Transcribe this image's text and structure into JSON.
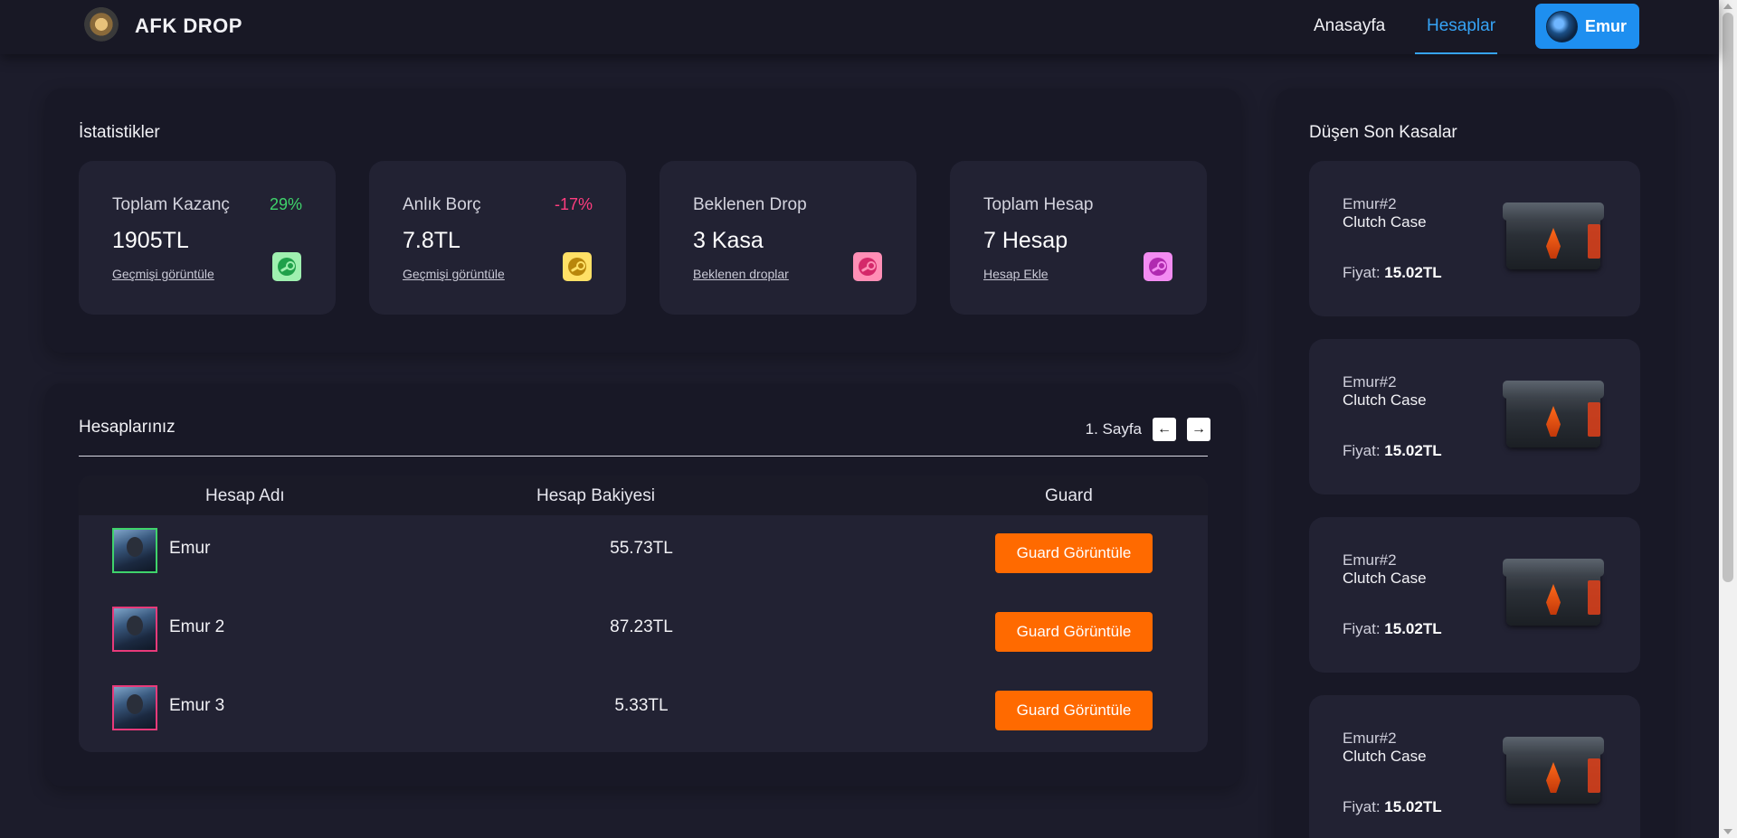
{
  "header": {
    "brand": "AFK DROP",
    "nav": [
      {
        "label": "Anasayfa"
      },
      {
        "label": "Hesaplar"
      }
    ],
    "user": {
      "name": "Emur"
    }
  },
  "stats": {
    "title": "İstatistikler",
    "cards": [
      {
        "label": "Toplam Kazanç",
        "percent": "29%",
        "percent_color": "#3fd36b",
        "value": "1905TL",
        "link": "Geçmişi görüntüle",
        "icon": "steam-icon",
        "icon_bg": "#9ff0b0",
        "icon_fg": "#1fa04a"
      },
      {
        "label": "Anlık Borç",
        "percent": "-17%",
        "percent_color": "#ff3d7f",
        "value": "7.8TL",
        "link": "Geçmişi görüntüle",
        "icon": "steam-icon",
        "icon_bg": "#ffe066",
        "icon_fg": "#b8860b"
      },
      {
        "label": "Beklenen Drop",
        "percent": "",
        "percent_color": "#ffffff",
        "value": "3 Kasa",
        "link": "Beklenen droplar",
        "icon": "steam-icon",
        "icon_bg": "#ff8fb6",
        "icon_fg": "#d4286a"
      },
      {
        "label": "Toplam Hesap",
        "percent": "",
        "percent_color": "#ffffff",
        "value": "7 Hesap",
        "link": "Hesap Ekle",
        "icon": "steam-icon",
        "icon_bg": "#f38cf2",
        "icon_fg": "#b02ab0"
      }
    ]
  },
  "accounts": {
    "title": "Hesaplarınız",
    "page_label": "1. Sayfa",
    "columns": [
      "Hesap Adı",
      "Hesap Bakiyesi",
      "Guard"
    ],
    "rows": [
      {
        "name": "Emur",
        "balance": "55.73TL",
        "guard": "Guard Görüntüle",
        "status_color": "#3fd36b"
      },
      {
        "name": "Emur 2",
        "balance": "87.23TL",
        "guard": "Guard Görüntüle",
        "status_color": "#e83a7a"
      },
      {
        "name": "Emur 3",
        "balance": "5.33TL",
        "guard": "Guard Görüntüle",
        "status_color": "#e83a7a"
      }
    ]
  },
  "drops": {
    "title": "Düşen Son Kasalar",
    "price_label": "Fiyat:",
    "items": [
      {
        "account": "Emur#2",
        "case": "Clutch Case",
        "price": "15.02TL"
      },
      {
        "account": "Emur#2",
        "case": "Clutch Case",
        "price": "15.02TL"
      },
      {
        "account": "Emur#2",
        "case": "Clutch Case",
        "price": "15.02TL"
      },
      {
        "account": "Emur#2",
        "case": "Clutch Case",
        "price": "15.02TL"
      }
    ]
  },
  "colors": {
    "accent": "#36a3f5",
    "user_button": "#1e8ff0",
    "guard_button": "#ff6a00",
    "background": "#1c1c2b",
    "panel": "#181826",
    "card": "#222233"
  }
}
